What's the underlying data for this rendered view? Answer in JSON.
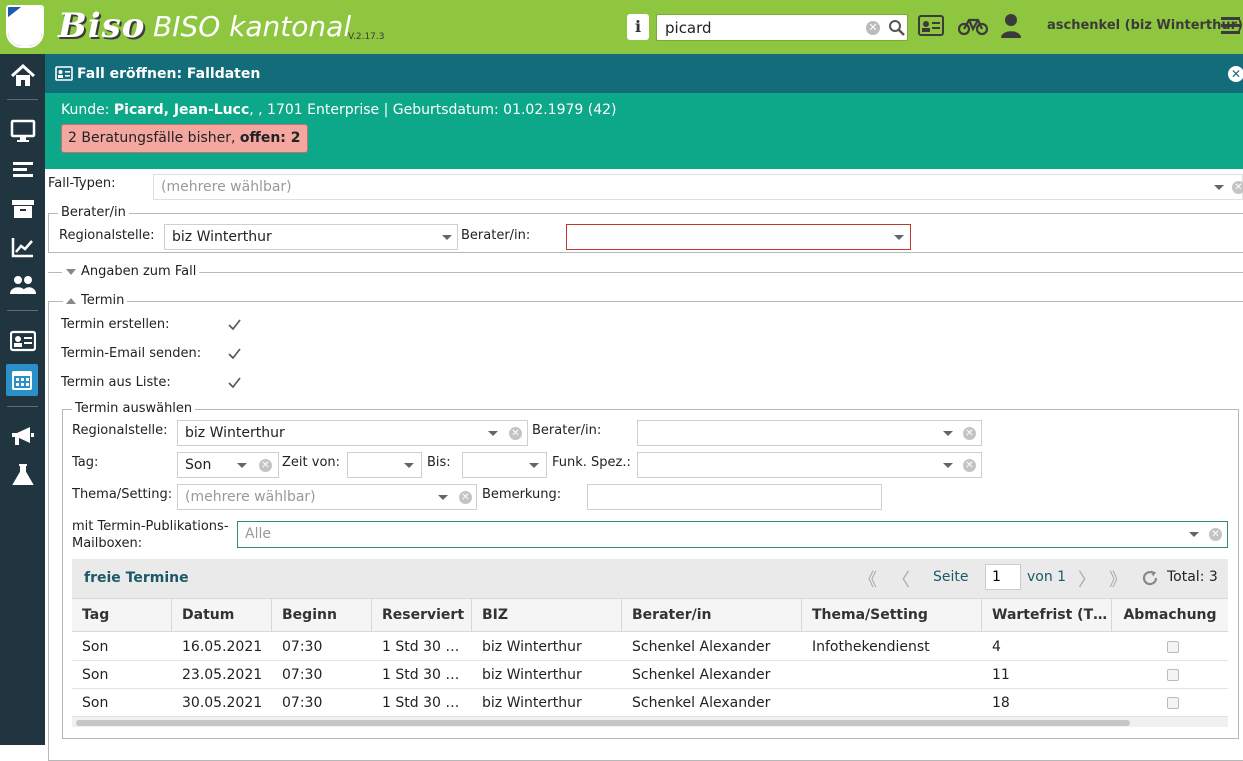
{
  "topbar": {
    "brand": "Biso",
    "app_title": "BISO kantonal",
    "version": "V.2.17.3",
    "info_label": "i",
    "search_value": "picard",
    "user": "aschenkel (biz Winterthur)",
    "icons": [
      "info-icon",
      "search-icon",
      "id-card-icon",
      "bicycle-icon",
      "user-icon",
      "menu-icon"
    ]
  },
  "sidebar": {
    "items": [
      "home-icon",
      "monitor-icon",
      "list-icon",
      "archive-icon",
      "chart-icon",
      "users-icon",
      "id-card-icon",
      "calendar-icon",
      "megaphone-icon",
      "flask-icon"
    ],
    "active": "calendar-icon",
    "colors": {
      "bg": "#20353f",
      "active": "#2b8fc8"
    }
  },
  "header": {
    "title": "Fall eröffnen: Falldaten",
    "close": "✕"
  },
  "customer": {
    "prefix": "Kunde: ",
    "name": "Picard, Jean-Lucc",
    "rest": ", , 1701 Enterprise | Geburtsdatum: 01.02.1979 (42)",
    "badge_text": "2 Beratungsfälle bisher, ",
    "badge_strong": "offen: 2"
  },
  "form": {
    "fall_typen_label": "Fall-Typen:",
    "fall_typen_placeholder": "(mehrere wählbar)",
    "berater_section": "Berater/in",
    "regionalstelle_label": "Regionalstelle:",
    "regionalstelle_value": "biz Winterthur",
    "berater_label": "Berater/in:",
    "berater_value": "",
    "angaben_section": "Angaben zum Fall",
    "termin_section": "Termin",
    "termin_erstellen_label": "Termin erstellen:",
    "termin_email_label": "Termin-Email senden:",
    "termin_liste_label": "Termin aus Liste:"
  },
  "termin_auswahl": {
    "legend": "Termin auswählen",
    "regionalstelle_label": "Regionalstelle:",
    "regionalstelle_value": "biz Winterthur",
    "berater_label": "Berater/in:",
    "tag_label": "Tag:",
    "tag_value": "Son",
    "zeit_von_label": "Zeit von:",
    "bis_label": "Bis:",
    "funk_label": "Funk. Spez.:",
    "thema_label": "Thema/Setting:",
    "thema_placeholder": "(mehrere wählbar)",
    "bemerkung_label": "Bemerkung:",
    "mailbox_label_1": "mit Termin-Publikations-",
    "mailbox_label_2": "Mailboxen:",
    "mailbox_placeholder": "Alle"
  },
  "grid": {
    "title": "freie Termine",
    "page_label": "Seite",
    "page": "1",
    "of_label": "von 1",
    "total_label": "Total: 3",
    "columns": [
      "Tag",
      "Datum",
      "Beginn",
      "Reserviert",
      "BIZ",
      "Berater/in",
      "Thema/Setting",
      "Wartefrist (T…",
      "Abmachung"
    ],
    "rows": [
      {
        "tag": "Son",
        "datum": "16.05.2021",
        "beginn": "07:30",
        "reserviert": "1 Std 30 …",
        "biz": "biz Winterthur",
        "berater": "Schenkel Alexander",
        "thema": "Infothekendienst",
        "wartefrist": "4"
      },
      {
        "tag": "Son",
        "datum": "23.05.2021",
        "beginn": "07:30",
        "reserviert": "1 Std 30 …",
        "biz": "biz Winterthur",
        "berater": "Schenkel Alexander",
        "thema": "",
        "wartefrist": "11"
      },
      {
        "tag": "Son",
        "datum": "30.05.2021",
        "beginn": "07:30",
        "reserviert": "1 Std 30 …",
        "biz": "biz Winterthur",
        "berater": "Schenkel Alexander",
        "thema": "",
        "wartefrist": "18"
      }
    ]
  },
  "colors": {
    "topbar": "#8ec63f",
    "header": "#136c7a",
    "customer_bar": "#0da889",
    "badge": "#f3a7a0"
  }
}
